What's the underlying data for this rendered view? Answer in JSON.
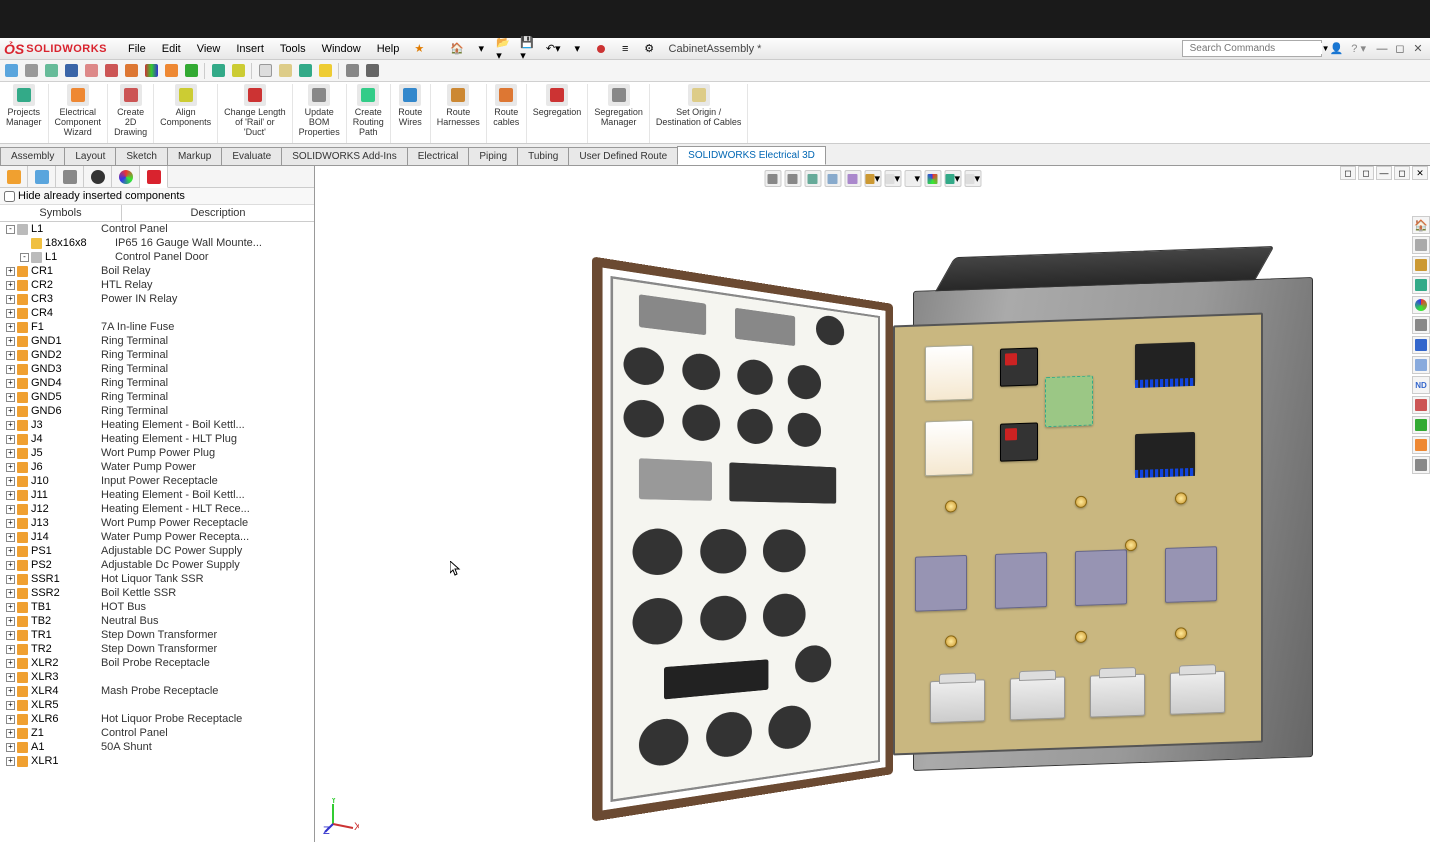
{
  "title": "CabinetAssembly *",
  "search": {
    "placeholder": "Search Commands"
  },
  "menu": [
    "File",
    "Edit",
    "View",
    "Insert",
    "Tools",
    "Window",
    "Help"
  ],
  "ribbon": [
    {
      "label": "Projects\nManager"
    },
    {
      "label": "Electrical\nComponent\nWizard"
    },
    {
      "label": "Create\n2D\nDrawing"
    },
    {
      "label": "Align\nComponents"
    },
    {
      "label": "Change Length\nof 'Rail' or\n'Duct'"
    },
    {
      "label": "Update\nBOM\nProperties"
    },
    {
      "label": "Create\nRouting\nPath"
    },
    {
      "label": "Route\nWires"
    },
    {
      "label": "Route\nHarnesses"
    },
    {
      "label": "Route\ncables"
    },
    {
      "label": "Segregation"
    },
    {
      "label": "Segregation\nManager"
    },
    {
      "label": "Set Origin /\nDestination of Cables"
    }
  ],
  "tabs": [
    "Assembly",
    "Layout",
    "Sketch",
    "Markup",
    "Evaluate",
    "SOLIDWORKS Add-Ins",
    "Electrical",
    "Piping",
    "Tubing",
    "User Defined Route",
    "SOLIDWORKS Electrical 3D"
  ],
  "activeTab": "SOLIDWORKS Electrical 3D",
  "side": {
    "hideLabel": "Hide already inserted components",
    "col1": "Symbols",
    "col2": "Description",
    "rows": [
      {
        "i": 0,
        "e": "-",
        "s": "L1",
        "d": "Control Panel",
        "ic": "#bbb"
      },
      {
        "i": 1,
        "e": "",
        "s": "18x16x8",
        "d": "IP65 16 Gauge Wall Mounte...",
        "ic": "#f0c040"
      },
      {
        "i": 1,
        "e": "-",
        "s": "L1",
        "d": "Control Panel Door",
        "ic": "#bbb"
      },
      {
        "i": 0,
        "e": "+",
        "s": "CR1",
        "d": "Boil Relay",
        "ic": "#f0a030"
      },
      {
        "i": 0,
        "e": "+",
        "s": "CR2",
        "d": "HTL Relay",
        "ic": "#f0a030"
      },
      {
        "i": 0,
        "e": "+",
        "s": "CR3",
        "d": "Power IN Relay",
        "ic": "#f0a030"
      },
      {
        "i": 0,
        "e": "+",
        "s": "CR4",
        "d": "",
        "ic": "#f0a030"
      },
      {
        "i": 0,
        "e": "+",
        "s": "F1",
        "d": "7A In-line Fuse",
        "ic": "#f0a030"
      },
      {
        "i": 0,
        "e": "+",
        "s": "GND1",
        "d": "Ring Terminal",
        "ic": "#f0a030"
      },
      {
        "i": 0,
        "e": "+",
        "s": "GND2",
        "d": "Ring Terminal",
        "ic": "#f0a030"
      },
      {
        "i": 0,
        "e": "+",
        "s": "GND3",
        "d": "Ring Terminal",
        "ic": "#f0a030"
      },
      {
        "i": 0,
        "e": "+",
        "s": "GND4",
        "d": "Ring Terminal",
        "ic": "#f0a030"
      },
      {
        "i": 0,
        "e": "+",
        "s": "GND5",
        "d": "Ring Terminal",
        "ic": "#f0a030"
      },
      {
        "i": 0,
        "e": "+",
        "s": "GND6",
        "d": "Ring Terminal",
        "ic": "#f0a030"
      },
      {
        "i": 0,
        "e": "+",
        "s": "J3",
        "d": "Heating Element - Boil Kettl...",
        "ic": "#f0a030"
      },
      {
        "i": 0,
        "e": "+",
        "s": "J4",
        "d": "Heating Element - HLT Plug",
        "ic": "#f0a030"
      },
      {
        "i": 0,
        "e": "+",
        "s": "J5",
        "d": "Wort Pump Power Plug",
        "ic": "#f0a030"
      },
      {
        "i": 0,
        "e": "+",
        "s": "J6",
        "d": "Water Pump Power",
        "ic": "#f0a030"
      },
      {
        "i": 0,
        "e": "+",
        "s": "J10",
        "d": "Input Power Receptacle",
        "ic": "#f0a030"
      },
      {
        "i": 0,
        "e": "+",
        "s": "J11",
        "d": "Heating Element - Boil Kettl...",
        "ic": "#f0a030"
      },
      {
        "i": 0,
        "e": "+",
        "s": "J12",
        "d": "Heating Element - HLT Rece...",
        "ic": "#f0a030"
      },
      {
        "i": 0,
        "e": "+",
        "s": "J13",
        "d": "Wort Pump Power Receptacle",
        "ic": "#f0a030"
      },
      {
        "i": 0,
        "e": "+",
        "s": "J14",
        "d": "Water Pump Power Recepta...",
        "ic": "#f0a030"
      },
      {
        "i": 0,
        "e": "+",
        "s": "PS1",
        "d": "Adjustable DC Power Supply",
        "ic": "#f0a030"
      },
      {
        "i": 0,
        "e": "+",
        "s": "PS2",
        "d": "Adjustable Dc Power Supply",
        "ic": "#f0a030"
      },
      {
        "i": 0,
        "e": "+",
        "s": "SSR1",
        "d": "Hot Liquor Tank SSR",
        "ic": "#f0a030"
      },
      {
        "i": 0,
        "e": "+",
        "s": "SSR2",
        "d": "Boil Kettle SSR",
        "ic": "#f0a030"
      },
      {
        "i": 0,
        "e": "+",
        "s": "TB1",
        "d": "HOT Bus",
        "ic": "#f0a030"
      },
      {
        "i": 0,
        "e": "+",
        "s": "TB2",
        "d": "Neutral Bus",
        "ic": "#f0a030"
      },
      {
        "i": 0,
        "e": "+",
        "s": "TR1",
        "d": "Step Down Transformer",
        "ic": "#f0a030"
      },
      {
        "i": 0,
        "e": "+",
        "s": "TR2",
        "d": "Step Down Transformer",
        "ic": "#f0a030"
      },
      {
        "i": 0,
        "e": "+",
        "s": "XLR2",
        "d": "Boil Probe Receptacle",
        "ic": "#f0a030"
      },
      {
        "i": 0,
        "e": "+",
        "s": "XLR3",
        "d": "",
        "ic": "#f0a030"
      },
      {
        "i": 0,
        "e": "+",
        "s": "XLR4",
        "d": "Mash Probe Receptacle",
        "ic": "#f0a030"
      },
      {
        "i": 0,
        "e": "+",
        "s": "XLR5",
        "d": "",
        "ic": "#f0a030"
      },
      {
        "i": 0,
        "e": "+",
        "s": "XLR6",
        "d": "Hot Liquor Probe Receptacle",
        "ic": "#f0a030"
      },
      {
        "i": 0,
        "e": "+",
        "s": "Z1",
        "d": "Control Panel",
        "ic": "#f0a030"
      },
      {
        "i": 0,
        "e": "+",
        "s": "A1",
        "d": "50A Shunt",
        "ic": "#f0a030"
      },
      {
        "i": 0,
        "e": "+",
        "s": "XLR1",
        "d": "",
        "ic": "#f0a030"
      }
    ]
  }
}
